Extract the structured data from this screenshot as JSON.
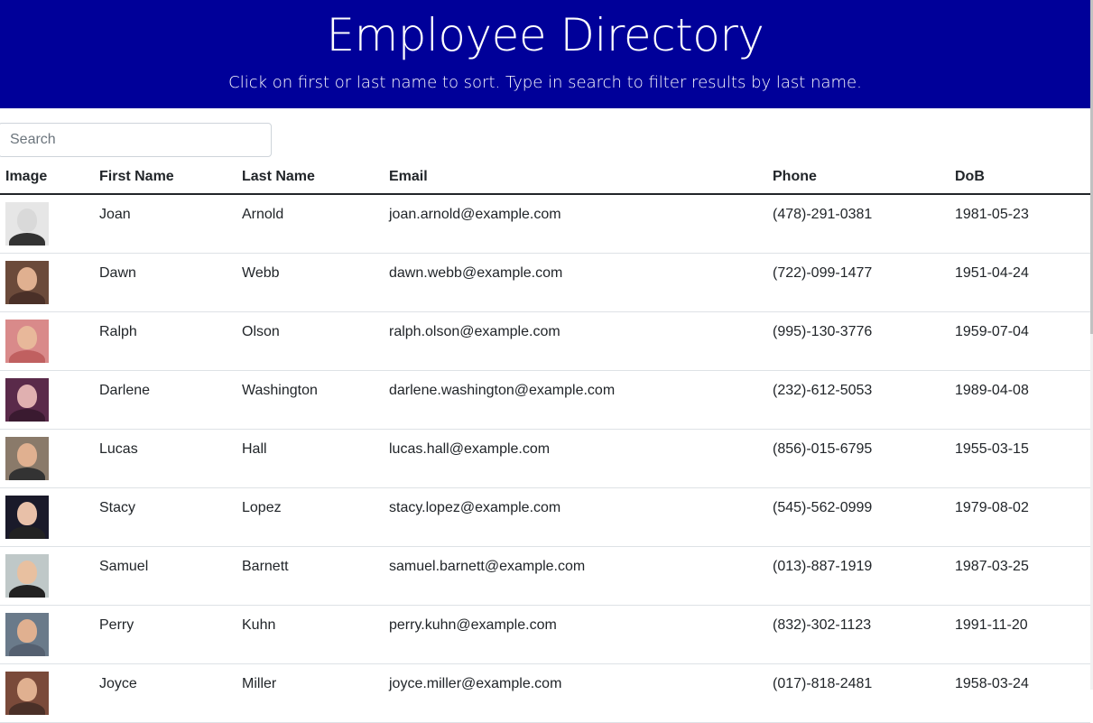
{
  "header": {
    "title": "Employee Directory",
    "subtitle": "Click on first or last name to sort. Type in search to filter results by last name."
  },
  "search": {
    "placeholder": "Search",
    "value": ""
  },
  "table": {
    "columns": [
      "Image",
      "First Name",
      "Last Name",
      "Email",
      "Phone",
      "DoB"
    ],
    "rows": [
      {
        "first": "Joan",
        "last": "Arnold",
        "email": "joan.arnold@example.com",
        "phone": "(478)-291-0381",
        "dob": "1981-05-23",
        "avatar": {
          "bg": "#e6e6e6",
          "skin": "#d9d9d9",
          "shirt": "#333333"
        }
      },
      {
        "first": "Dawn",
        "last": "Webb",
        "email": "dawn.webb@example.com",
        "phone": "(722)-099-1477",
        "dob": "1951-04-24",
        "avatar": {
          "bg": "#6b4a3a",
          "skin": "#e0b090",
          "shirt": "#4a3028"
        }
      },
      {
        "first": "Ralph",
        "last": "Olson",
        "email": "ralph.olson@example.com",
        "phone": "(995)-130-3776",
        "dob": "1959-07-04",
        "avatar": {
          "bg": "#d98a8a",
          "skin": "#e8b89a",
          "shirt": "#c06060"
        }
      },
      {
        "first": "Darlene",
        "last": "Washington",
        "email": "darlene.washington@example.com",
        "phone": "(232)-612-5053",
        "dob": "1989-04-08",
        "avatar": {
          "bg": "#5a2a4a",
          "skin": "#e0b0b0",
          "shirt": "#3a1a30"
        }
      },
      {
        "first": "Lucas",
        "last": "Hall",
        "email": "lucas.hall@example.com",
        "phone": "(856)-015-6795",
        "dob": "1955-03-15",
        "avatar": {
          "bg": "#8a7a6a",
          "skin": "#e0b090",
          "shirt": "#333333"
        }
      },
      {
        "first": "Stacy",
        "last": "Lopez",
        "email": "stacy.lopez@example.com",
        "phone": "(545)-562-0999",
        "dob": "1979-08-02",
        "avatar": {
          "bg": "#1a1a2a",
          "skin": "#e8c0a8",
          "shirt": "#222222"
        }
      },
      {
        "first": "Samuel",
        "last": "Barnett",
        "email": "samuel.barnett@example.com",
        "phone": "(013)-887-1919",
        "dob": "1987-03-25",
        "avatar": {
          "bg": "#bfc8c8",
          "skin": "#e8c0a0",
          "shirt": "#222222"
        }
      },
      {
        "first": "Perry",
        "last": "Kuhn",
        "email": "perry.kuhn@example.com",
        "phone": "(832)-302-1123",
        "dob": "1991-11-20",
        "avatar": {
          "bg": "#6a7a8a",
          "skin": "#e0b090",
          "shirt": "#556070"
        }
      },
      {
        "first": "Joyce",
        "last": "Miller",
        "email": "joyce.miller@example.com",
        "phone": "(017)-818-2481",
        "dob": "1958-03-24",
        "avatar": {
          "bg": "#7a4a3a",
          "skin": "#e0b090",
          "shirt": "#4a3028"
        }
      }
    ]
  }
}
